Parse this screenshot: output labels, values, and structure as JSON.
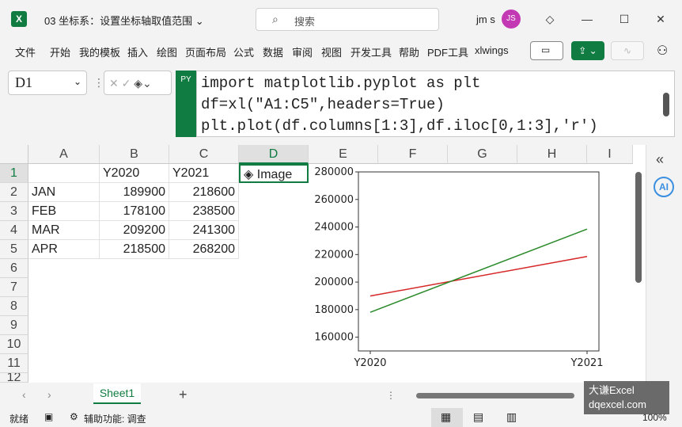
{
  "title_bar": {
    "doc_title": "03 坐标系：设置坐标轴取值范围",
    "search_placeholder": "搜索",
    "user_name": "jm s",
    "avatar_initials": "JS",
    "app_logo": "X"
  },
  "menu": {
    "items": [
      "文件",
      "开始",
      "我的模板",
      "插入",
      "绘图",
      "页面布局",
      "公式",
      "数据",
      "审阅",
      "视图",
      "开发工具",
      "帮助",
      "PDF工具",
      "xlwings"
    ]
  },
  "formula_bar": {
    "name_box": "D1",
    "py_badge": "PY",
    "code": "import matplotlib.pyplot as plt\ndf=xl(\"A1:C5\",headers=True)\nplt.plot(df.columns[1:3],df.iloc[0,1:3],'r')"
  },
  "columns": [
    "A",
    "B",
    "C",
    "D",
    "E",
    "F",
    "G",
    "H",
    "I"
  ],
  "rows": [
    "1",
    "2",
    "3",
    "4",
    "5",
    "6",
    "7",
    "8",
    "9",
    "10",
    "11",
    "12"
  ],
  "cells": {
    "header": [
      "",
      "Y2020",
      "Y2021",
      "Image"
    ],
    "data": [
      [
        "JAN",
        "189900",
        "218600"
      ],
      [
        "FEB",
        "178100",
        "238500"
      ],
      [
        "MAR",
        "209200",
        "241300"
      ],
      [
        "APR",
        "218500",
        "268200"
      ]
    ]
  },
  "chart_data": {
    "type": "line",
    "categories": [
      "Y2020",
      "Y2021"
    ],
    "series": [
      {
        "color": "#d62728",
        "values": [
          189900,
          218600
        ]
      },
      {
        "color": "#2a8a2a",
        "values": [
          178100,
          238500
        ]
      }
    ],
    "ylim": [
      150000,
      280000
    ],
    "yticks": [
      "160000",
      "180000",
      "200000",
      "220000",
      "240000",
      "260000",
      "280000"
    ]
  },
  "sheets": {
    "active": "Sheet1",
    "add": "+"
  },
  "status": {
    "ready": "就绪",
    "accessibility": "辅助功能: 调查",
    "zoom": "100%"
  },
  "watermark": {
    "line1": "大谦Excel",
    "line2": "dqexcel.com"
  },
  "right_panel": {
    "ai_label": "AI",
    "collapse": "«"
  }
}
